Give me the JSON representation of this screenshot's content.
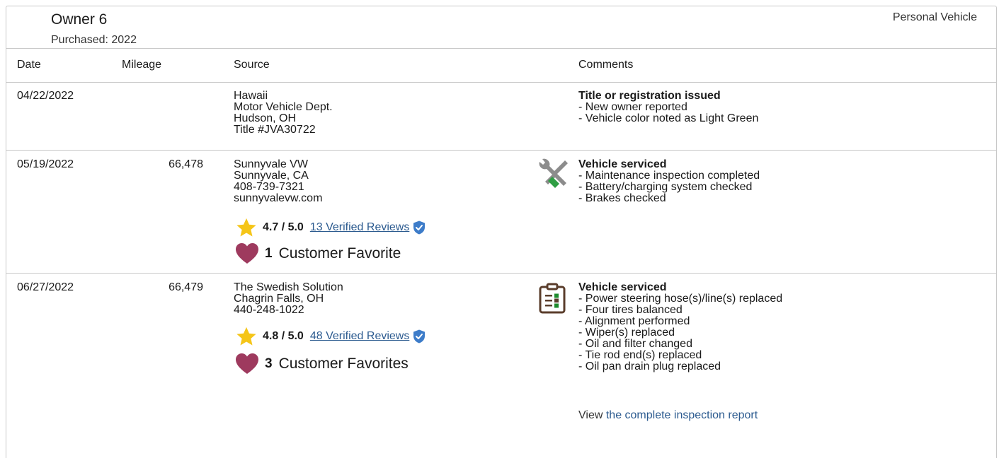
{
  "owner": {
    "title": "Owner 6",
    "purchased": "Purchased: 2022",
    "vehicle_type": "Personal Vehicle"
  },
  "columns": {
    "date": "Date",
    "mileage": "Mileage",
    "source": "Source",
    "comments": "Comments"
  },
  "records": [
    {
      "date": "04/22/2022",
      "mileage": "",
      "source_lines": [
        "Hawaii",
        "Motor Vehicle Dept.",
        "Hudson, OH",
        "Title #JVA30722"
      ],
      "comment_title": "Title or registration issued",
      "comment_lines": [
        "- New owner reported",
        "- Vehicle color noted as Light Green"
      ]
    },
    {
      "date": "05/19/2022",
      "mileage": "66,478",
      "source_lines": [
        "Sunnyvale VW",
        "Sunnyvale, CA",
        "408-739-7321",
        "sunnyvalevw.com"
      ],
      "rating": "4.7 / 5.0",
      "reviews_link": "13 Verified Reviews",
      "favorites_count": "1",
      "favorites_label": "Customer Favorite",
      "comment_icon": "wrench-screwdriver-icon",
      "comment_title": "Vehicle serviced",
      "comment_lines": [
        "- Maintenance inspection completed",
        "- Battery/charging system checked",
        "- Brakes checked"
      ]
    },
    {
      "date": "06/27/2022",
      "mileage": "66,479",
      "source_lines": [
        "The Swedish Solution",
        "Chagrin Falls, OH",
        "440-248-1022"
      ],
      "rating": "4.8 / 5.0",
      "reviews_link": "48 Verified Reviews",
      "favorites_count": "3",
      "favorites_label": "Customer Favorites",
      "comment_icon": "clipboard-checklist-icon",
      "comment_title": "Vehicle serviced",
      "comment_lines": [
        "- Power steering hose(s)/line(s) replaced",
        "- Four tires balanced",
        "- Alignment performed",
        "- Wiper(s) replaced",
        "- Oil and filter changed",
        "- Tie rod end(s) replaced",
        "- Oil pan drain plug replaced"
      ],
      "report_prefix": "View",
      "report_link": "the complete inspection report"
    }
  ],
  "colors": {
    "star": "#f5c518",
    "heart": "#9e3a5e",
    "link": "#2b5a8f",
    "shield": "#3d7cc9",
    "border": "#c8c8c8"
  }
}
